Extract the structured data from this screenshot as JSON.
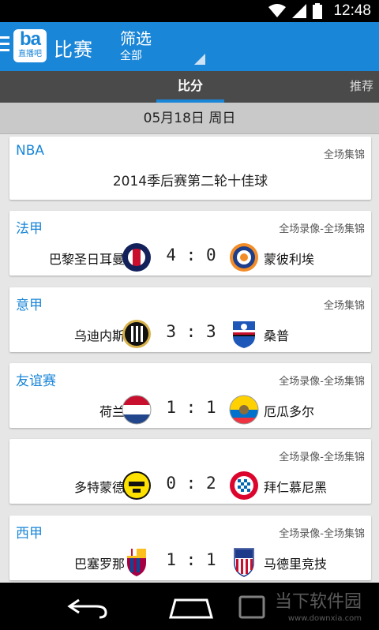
{
  "status_bar": {
    "time": "12:48"
  },
  "action_bar": {
    "logo_big": "ba",
    "logo_small": "直播吧",
    "title": "比赛",
    "filter_label": "筛选",
    "filter_value": "全部"
  },
  "tabs": {
    "score": "比分",
    "recommend": "推荐"
  },
  "date_header": "05月18日 周日",
  "cards": [
    {
      "league": "NBA",
      "tag": "全场集锦",
      "highlight": "2014季后赛第二轮十佳球"
    },
    {
      "league": "法甲",
      "tag": "全场录像-全场集锦",
      "home": "巴黎圣日耳曼",
      "score": "4 : 0",
      "away": "蒙彼利埃"
    },
    {
      "league": "意甲",
      "tag": "全场集锦",
      "home": "乌迪内斯",
      "score": "3 : 3",
      "away": "桑普"
    },
    {
      "league": "友谊赛",
      "tag": "全场录像-全场集锦",
      "home": "荷兰",
      "score": "1 : 1",
      "away": "厄瓜多尔"
    },
    {
      "league": "",
      "tag": "全场录像-全场集锦",
      "home": "多特蒙德",
      "score": "0 : 2",
      "away": "拜仁慕尼黑"
    },
    {
      "league": "西甲",
      "tag": "全场录像-全场集锦",
      "home": "巴塞罗那",
      "score": "1 : 1",
      "away": "马德里竞技"
    }
  ],
  "watermark": {
    "main": "当下软件园",
    "sub": "www.downxia.com"
  },
  "colors": {
    "accent": "#1a86d8",
    "tab_bar": "#4a4a4a",
    "date_bar": "#c9c9c9"
  }
}
